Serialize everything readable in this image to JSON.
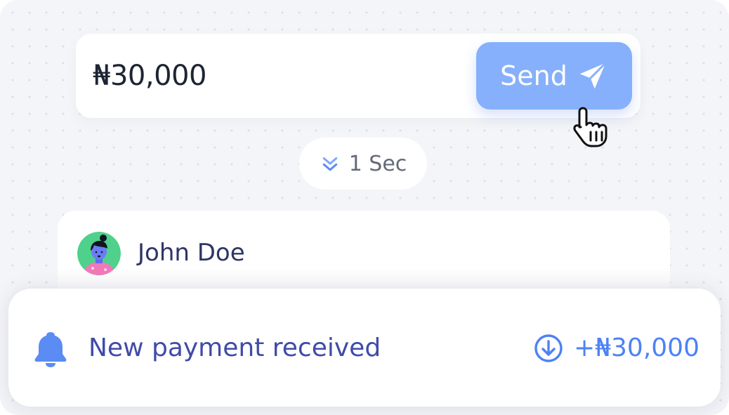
{
  "transfer": {
    "amount": "₦30,000",
    "send_label": "Send"
  },
  "timer": {
    "label": "1 Sec"
  },
  "recipient": {
    "name": "John Doe"
  },
  "notification": {
    "message": "New payment received",
    "amount": "+₦30,000"
  },
  "icons": {
    "send": "paper-plane-icon",
    "cursor": "hand-pointer-icon",
    "timer": "double-chevron-down-icon",
    "notification": "bell-icon",
    "received": "arrow-down-circle-icon"
  },
  "colors": {
    "accent": "#86b0fb",
    "notification_text": "#3f4ba8",
    "amount_positive": "#4d82f5",
    "name_text": "#2e3566"
  }
}
